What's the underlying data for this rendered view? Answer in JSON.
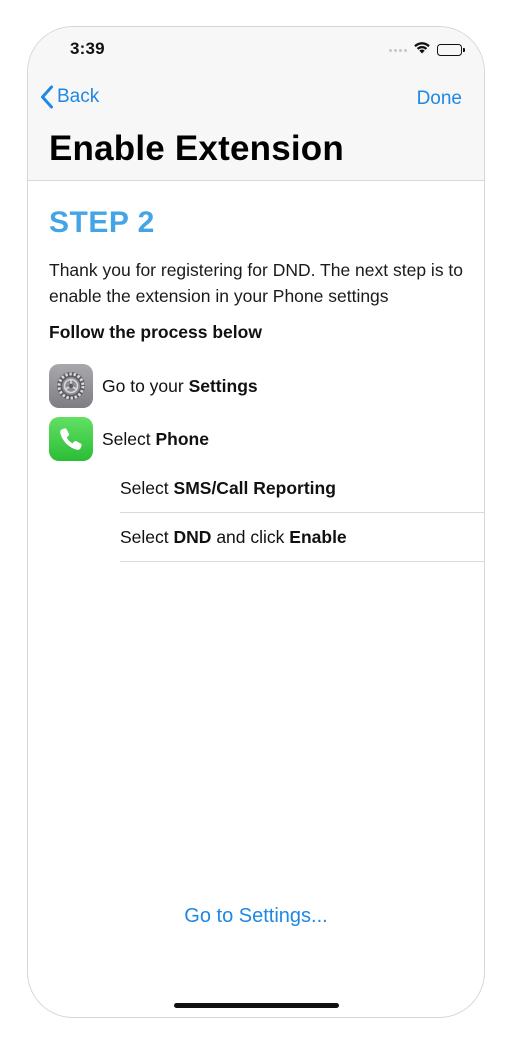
{
  "status_bar": {
    "time": "3:39"
  },
  "nav": {
    "back_label": "Back",
    "done_label": "Done",
    "title": "Enable Extension"
  },
  "content": {
    "step_title": "STEP 2",
    "intro_text": "Thank you for registering for DND. The next step is to enable the extension in your Phone settings",
    "follow_text": "Follow the process below",
    "steps": [
      {
        "icon": "settings-app-icon",
        "prefix": "Go to your ",
        "bold": "Settings"
      },
      {
        "icon": "phone-app-icon",
        "prefix": "Select ",
        "bold": "Phone"
      }
    ],
    "sub_steps": [
      {
        "prefix": "Select ",
        "bold": "SMS/Call Reporting"
      },
      {
        "prefix": "Select ",
        "bold": "DND",
        "middle": " and click ",
        "bold2": "Enable"
      }
    ]
  },
  "footer": {
    "go_to_settings_label": "Go to Settings..."
  },
  "colors": {
    "accent": "#1e88e5",
    "step_title": "#43a5e6",
    "phone_icon": "#34c13d",
    "settings_icon": "#8e8e93"
  }
}
